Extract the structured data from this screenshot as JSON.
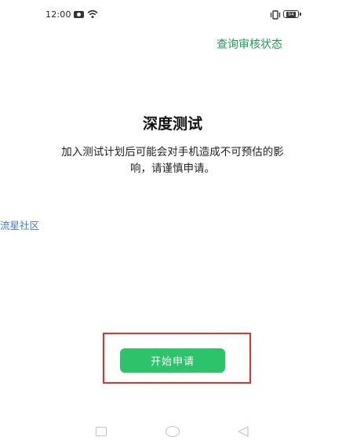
{
  "status_bar": {
    "time": "12:00",
    "battery": "94",
    "icons": [
      "camera-icon",
      "wifi-icon",
      "vibrate-icon",
      "battery-icon"
    ]
  },
  "header": {
    "status_link": "查询审核状态"
  },
  "main": {
    "title": "深度测试",
    "description": "加入测试计划后可能会对手机造成不可预估的影响，请谨慎申请。",
    "community_link": "流星社区",
    "start_button": "开始申请"
  },
  "nav_bar": {
    "icons": [
      "recent-apps-icon",
      "home-icon",
      "back-icon"
    ]
  },
  "colors": {
    "accent_green": "#2cc36b",
    "link_green": "#1e9f59",
    "link_blue": "#3d7cc9",
    "highlight_red": "#e03131"
  }
}
